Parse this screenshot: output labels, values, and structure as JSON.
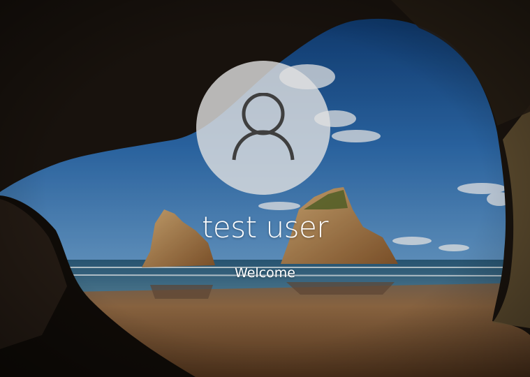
{
  "lock_screen": {
    "user_name": "test user",
    "status_text": "Welcome",
    "avatar_icon": "user-silhouette-icon"
  },
  "colors": {
    "sky_top": "#0e3f7a",
    "sky_bottom": "#4c8ccd",
    "sea": "#3a6f8e",
    "sand": "#a07246",
    "cave_rock": "#1a1410",
    "avatar_tile": "#e1e1e1",
    "avatar_glyph": "#3f3f3f",
    "text": "#ffffff"
  }
}
